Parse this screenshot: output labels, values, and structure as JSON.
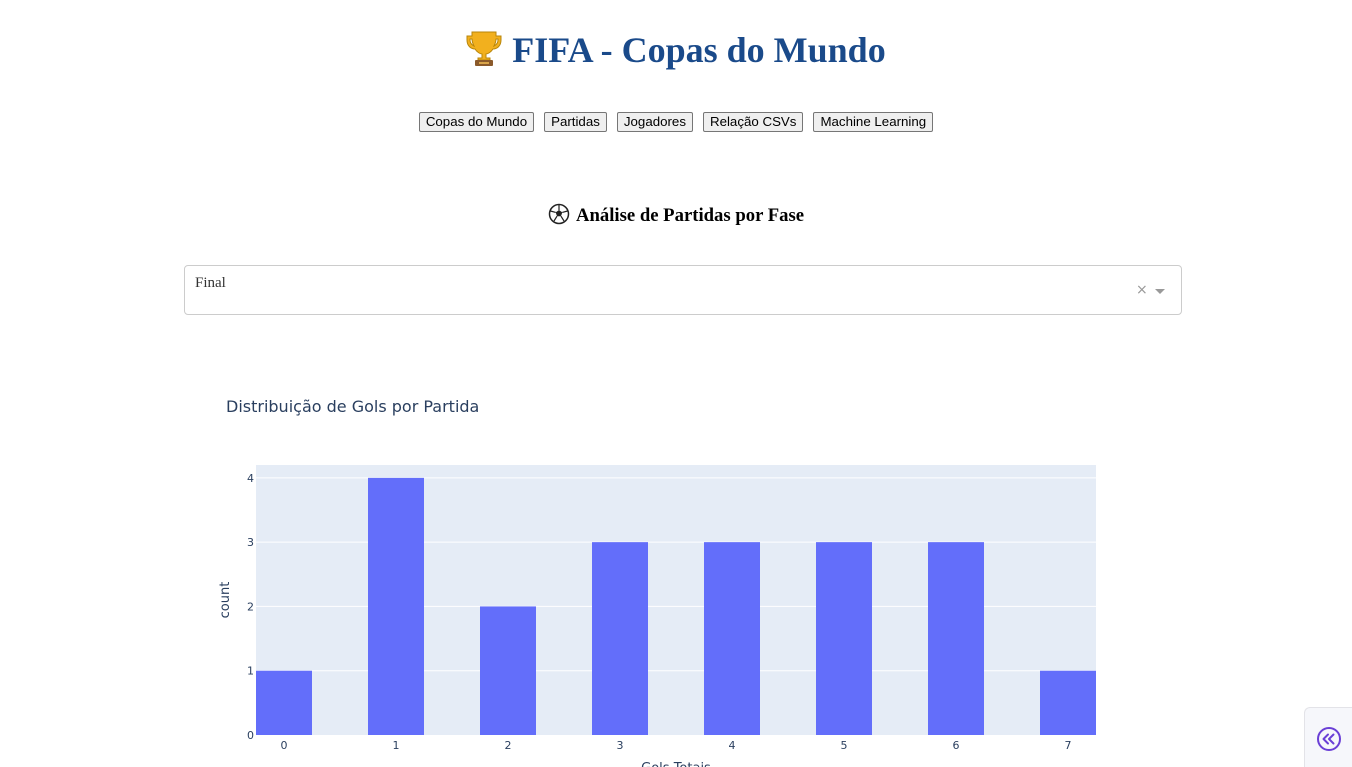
{
  "header": {
    "title": "FIFA - Copas do Mundo",
    "icon": "trophy-icon"
  },
  "nav": {
    "buttons": [
      "Copas do Mundo",
      "Partidas",
      "Jogadores",
      "Relação CSVs",
      "Machine Learning"
    ]
  },
  "section": {
    "title": "Análise de Partidas por Fase",
    "icon": "soccer-ball-icon"
  },
  "phase_select": {
    "value": "Final",
    "clear_glyph": "×"
  },
  "chart_data": {
    "type": "bar",
    "title": "Distribuição de Gols por Partida",
    "xlabel": "Gols Totais",
    "ylabel": "count",
    "categories": [
      "0",
      "1",
      "2",
      "3",
      "4",
      "5",
      "6",
      "7"
    ],
    "values": [
      1,
      4,
      2,
      3,
      3,
      3,
      3,
      1
    ],
    "ylim": [
      0,
      4.2
    ],
    "yticks": [
      0,
      1,
      2,
      3,
      4
    ],
    "bar_color": "#636efa",
    "plot_bg": "#e5ecf6",
    "grid": true
  },
  "colors": {
    "title": "#1a4a8a",
    "chart_text": "#2a3f5f",
    "toggle_icon": "#6a3fd6"
  }
}
